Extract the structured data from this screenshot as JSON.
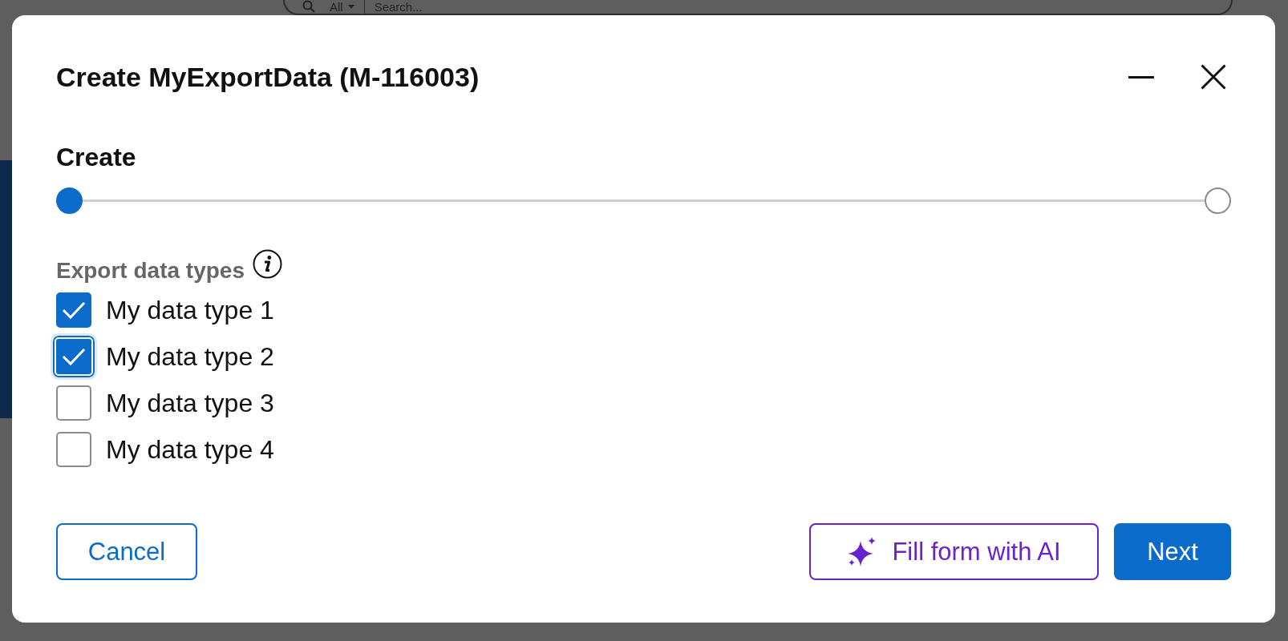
{
  "background": {
    "search": {
      "scope": "All",
      "placeholder": "Search..."
    }
  },
  "dialog": {
    "title": "Create MyExportData (M-116003)",
    "step": {
      "label": "Create",
      "steps": [
        {
          "selected": true
        },
        {
          "selected": false
        }
      ]
    },
    "field": {
      "label": "Export data types",
      "options": [
        {
          "label": "My data type 1",
          "checked": true,
          "focused": false
        },
        {
          "label": "My data type 2",
          "checked": true,
          "focused": true
        },
        {
          "label": "My data type 3",
          "checked": false,
          "focused": false
        },
        {
          "label": "My data type 4",
          "checked": false,
          "focused": false
        }
      ]
    },
    "buttons": [
      {
        "kind": "secondary",
        "label": "Cancel"
      },
      {
        "kind": "ai",
        "label": "Fill form with AI"
      },
      {
        "kind": "primary",
        "label": "Next"
      }
    ]
  }
}
